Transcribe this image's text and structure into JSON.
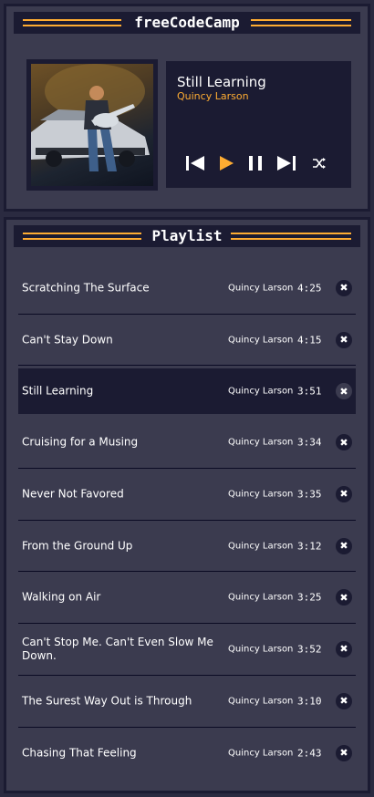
{
  "player": {
    "brand": "freeCodeCamp",
    "now_playing": {
      "title": "Still Learning",
      "artist": "Quincy Larson"
    },
    "controls": {
      "previous_icon": "skip-previous-icon",
      "play_icon": "play-icon",
      "pause_icon": "pause-icon",
      "next_icon": "skip-next-icon",
      "shuffle_icon": "shuffle-icon"
    }
  },
  "playlist": {
    "heading": "Playlist",
    "delete_icon": "close-icon",
    "delete_glyph": "✖",
    "active_index": 2,
    "songs": [
      {
        "title": "Scratching The Surface",
        "artist": "Quincy Larson",
        "duration": "4:25"
      },
      {
        "title": "Can't Stay Down",
        "artist": "Quincy Larson",
        "duration": "4:15"
      },
      {
        "title": "Still Learning",
        "artist": "Quincy Larson",
        "duration": "3:51"
      },
      {
        "title": "Cruising for a Musing",
        "artist": "Quincy Larson",
        "duration": "3:34"
      },
      {
        "title": "Never Not Favored",
        "artist": "Quincy Larson",
        "duration": "3:35"
      },
      {
        "title": "From the Ground Up",
        "artist": "Quincy Larson",
        "duration": "3:12"
      },
      {
        "title": "Walking on Air",
        "artist": "Quincy Larson",
        "duration": "3:25"
      },
      {
        "title": "Can't Stop Me. Can't Even Slow Me Down.",
        "artist": "Quincy Larson",
        "duration": "3:52"
      },
      {
        "title": "The Surest Way Out is Through",
        "artist": "Quincy Larson",
        "duration": "3:10"
      },
      {
        "title": "Chasing That Feeling",
        "artist": "Quincy Larson",
        "duration": "2:43"
      }
    ]
  },
  "colors": {
    "background": "#2a2a40",
    "panel": "#3b3b4f",
    "dark": "#1b1b32",
    "accent": "#feac32",
    "text": "#ffffff"
  }
}
